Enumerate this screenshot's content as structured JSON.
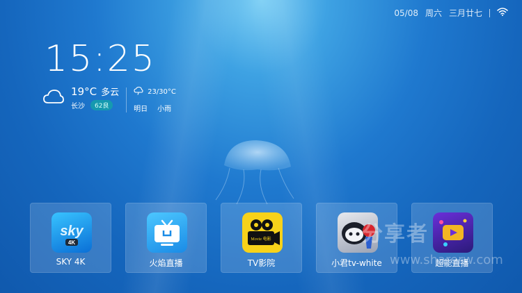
{
  "status": {
    "date": "05/08",
    "weekday": "周六",
    "lunar": "三月廿七",
    "wifi_icon": "wifi-icon"
  },
  "clock": {
    "time": "15:25"
  },
  "weather": {
    "icon": "cloud-icon",
    "temperature": "19°C",
    "condition": "多云",
    "city": "长沙",
    "aqi": "62良",
    "forecast_icon": "rain-cloud-icon",
    "forecast_range": "23/30°C",
    "forecast_day": "明日",
    "forecast_condition": "小雨"
  },
  "apps": [
    {
      "label": "SKY 4K",
      "icon": "sky-4k-icon"
    },
    {
      "label": "火焰直播",
      "icon": "tv-icon"
    },
    {
      "label": "TV影院",
      "icon": "film-camera-icon"
    },
    {
      "label": "小君tv-white",
      "icon": "character-icon"
    },
    {
      "label": "超能直播",
      "icon": "play-icon"
    }
  ],
  "icon_text": {
    "sky": "sky",
    "sky_4k": "4K",
    "movie": "Movie 电影"
  },
  "watermark": {
    "text": "分享者",
    "url": "www.sharerw.com"
  }
}
